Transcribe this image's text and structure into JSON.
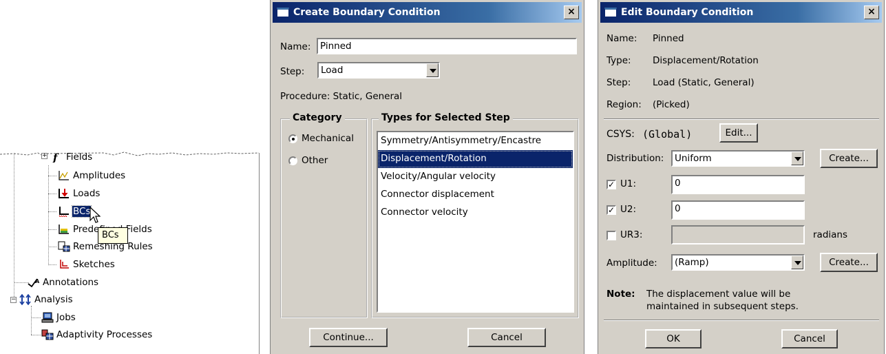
{
  "tree": {
    "items": [
      {
        "label": "Fields",
        "icon": "fields-icon"
      },
      {
        "label": "Amplitudes",
        "icon": "amplitudes-icon"
      },
      {
        "label": "Loads",
        "icon": "loads-icon"
      },
      {
        "label": "BCs",
        "icon": "bcs-icon"
      },
      {
        "label": "Predefined Fields",
        "icon": "predefined-fields-icon"
      },
      {
        "label": "Remeshing Rules",
        "icon": "remeshing-rules-icon"
      },
      {
        "label": "Sketches",
        "icon": "sketches-icon"
      },
      {
        "label": "Annotations",
        "icon": "annotations-icon"
      },
      {
        "label": "Analysis",
        "icon": "analysis-icon"
      },
      {
        "label": "Jobs",
        "icon": "jobs-icon"
      },
      {
        "label": "Adaptivity Processes",
        "icon": "adaptivity-processes-icon"
      }
    ],
    "tooltip": "BCs",
    "expander_plus": "+",
    "expander_minus": "−"
  },
  "create_dialog": {
    "title": "Create Boundary Condition",
    "close": "×",
    "name_label": "Name:",
    "name_value": "Pinned",
    "step_label": "Step:",
    "step_value": "Load",
    "procedure": "Procedure:  Static, General",
    "category_title": "Category",
    "categories": [
      "Mechanical",
      "Other"
    ],
    "category_selected": "Mechanical",
    "types_title": "Types for Selected Step",
    "types": [
      "Symmetry/Antisymmetry/Encastre",
      "Displacement/Rotation",
      "Velocity/Angular velocity",
      "Connector displacement",
      "Connector velocity"
    ],
    "type_selected": "Displacement/Rotation",
    "continue_label": "Continue...",
    "cancel_label": "Cancel"
  },
  "edit_dialog": {
    "title": "Edit Boundary Condition",
    "close": "×",
    "name_label": "Name:",
    "name_value": "Pinned",
    "type_label": "Type:",
    "type_value": "Displacement/Rotation",
    "step_label": "Step:",
    "step_value": "Load (Static, General)",
    "region_label": "Region:",
    "region_value": "(Picked)",
    "csys_label": "CSYS:",
    "csys_value": "(Global)",
    "edit_label": "Edit...",
    "distribution_label": "Distribution:",
    "distribution_value": "Uniform",
    "create_label": "Create...",
    "u1_label": "U1:",
    "u1_value": "0",
    "u1_checked": true,
    "u2_label": "U2:",
    "u2_value": "0",
    "u2_checked": true,
    "ur3_label": "UR3:",
    "ur3_value": "",
    "ur3_checked": false,
    "ur3_unit": "radians",
    "amplitude_label": "Amplitude:",
    "amplitude_value": "(Ramp)",
    "note_label": "Note:",
    "note_line1": "The displacement value will be",
    "note_line2": "maintained in subsequent steps.",
    "ok_label": "OK",
    "cancel_label": "Cancel",
    "check_mark": "✓"
  }
}
